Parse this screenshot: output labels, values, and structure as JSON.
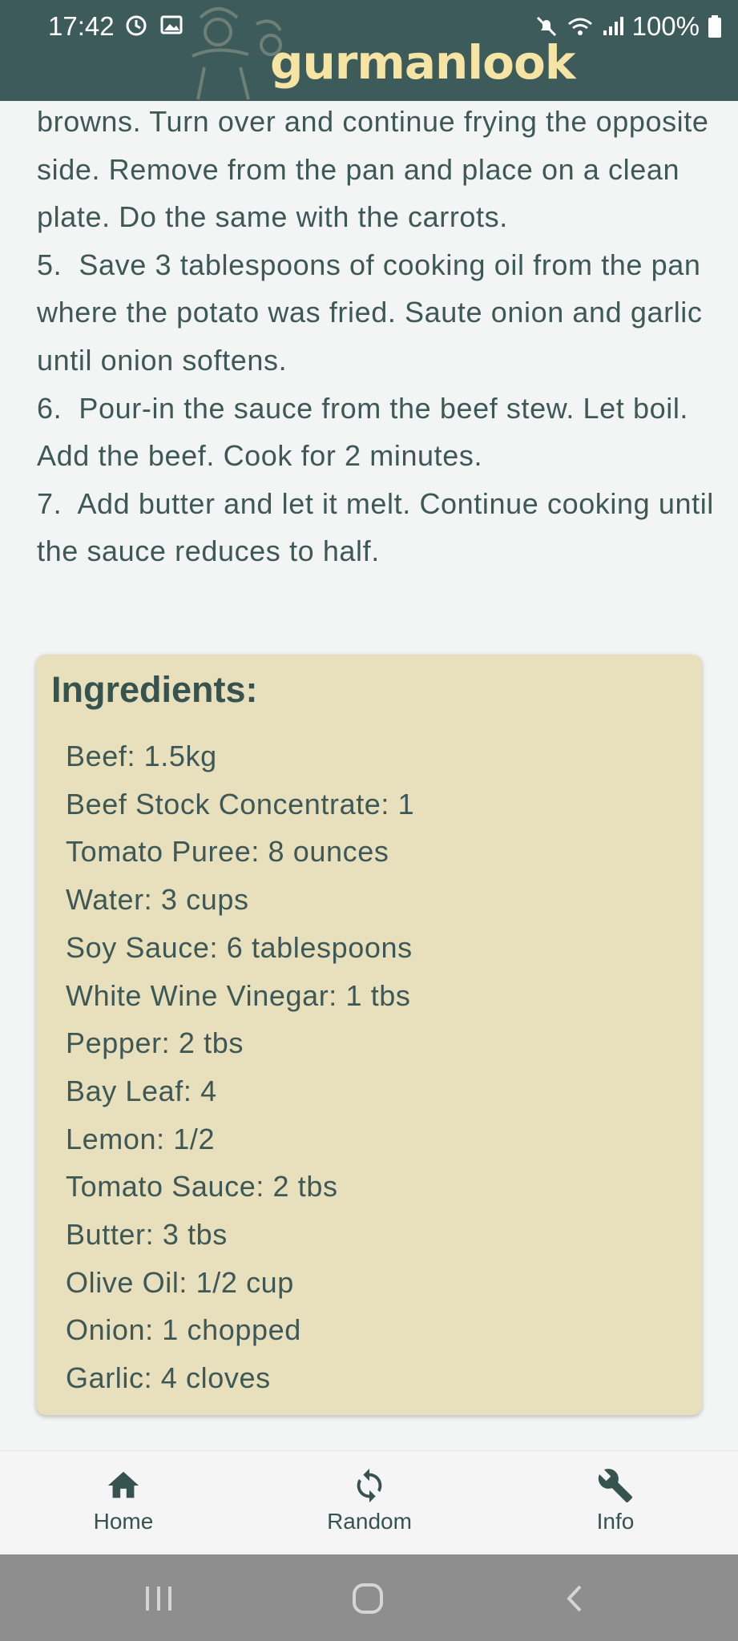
{
  "status_bar": {
    "time": "17:42",
    "battery": "100%",
    "left_icons": [
      "alarm-icon",
      "image-icon"
    ],
    "right_icons": [
      "mute-icon",
      "wifi-icon",
      "signal-icon",
      "battery-icon"
    ]
  },
  "header": {
    "brand": "gurmanlook",
    "bg_color": "#3e5b5b",
    "brand_color": "#f6e4a4"
  },
  "instructions": {
    "lines": [
      "browns. Turn over and continue frying the opposite side. Remove from the pan and place on a clean plate. Do the same with the carrots.",
      "5.  Save 3 tablespoons of cooking oil from the pan where the potato was fried. Saute onion and garlic until onion softens.",
      "6.  Pour-in the sauce from the beef stew. Let boil. Add the beef. Cook for 2 minutes.",
      "7.  Add butter and let it melt. Continue cooking until the sauce reduces to half."
    ]
  },
  "ingredients": {
    "title": "Ingredients:",
    "card_color": "#e8dfbc",
    "items": [
      "Beef: 1.5kg",
      "Beef Stock Concentrate: 1",
      "Tomato Puree: 8 ounces",
      "Water: 3 cups",
      "Soy Sauce: 6 tablespoons",
      "White Wine Vinegar: 1 tbs",
      "Pepper: 2 tbs",
      "Bay Leaf: 4",
      "Lemon: 1/2",
      "Tomato Sauce: 2 tbs",
      "Butter: 3 tbs",
      "Olive Oil: 1/2 cup",
      "Onion: 1 chopped",
      "Garlic: 4 cloves"
    ]
  },
  "bottom_nav": {
    "items": [
      {
        "label": "Home",
        "icon": "home-icon"
      },
      {
        "label": "Random",
        "icon": "refresh-icon"
      },
      {
        "label": "Info",
        "icon": "wrench-icon"
      }
    ]
  },
  "system_nav": {
    "buttons": [
      "recents-icon",
      "home-circle-icon",
      "back-icon"
    ]
  }
}
